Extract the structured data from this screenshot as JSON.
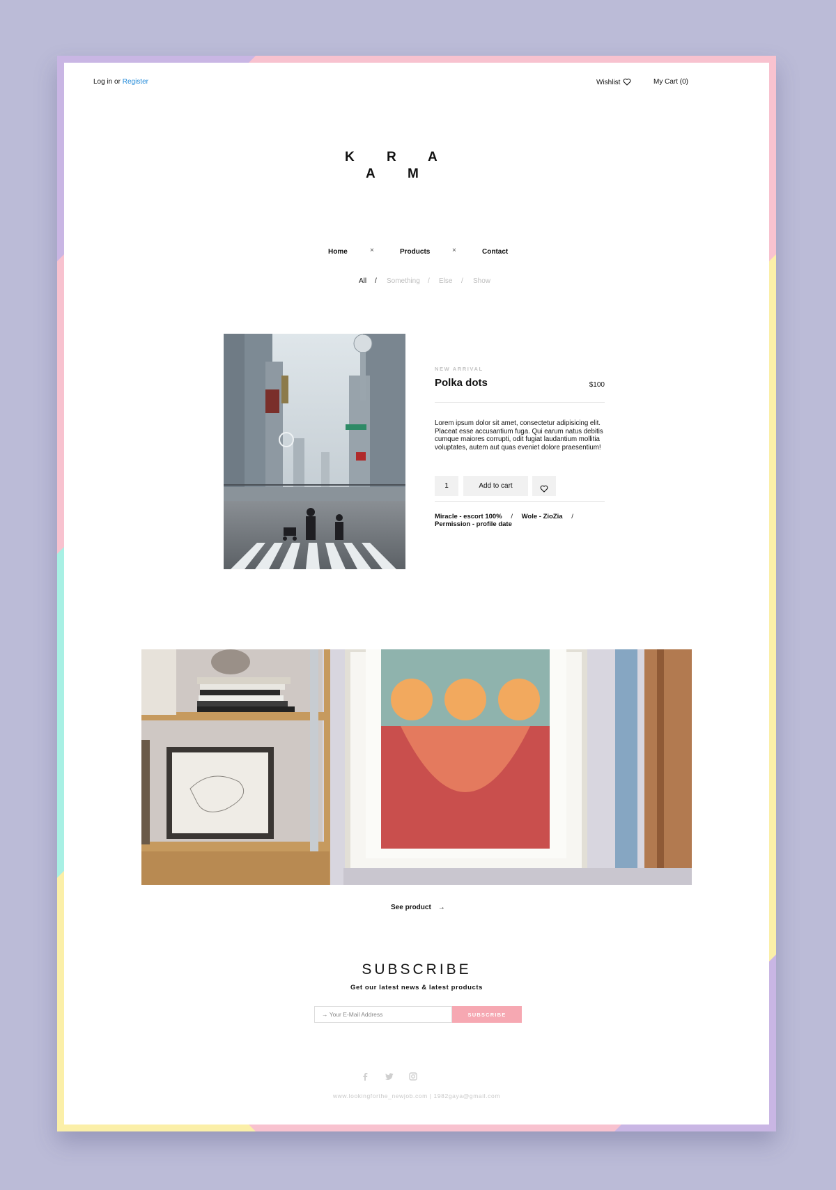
{
  "header": {
    "login_label": "Log in",
    "or_label": "or",
    "register_label": "Register",
    "wishlist_label": "Wishlist",
    "cart_label": "My Cart (0)"
  },
  "logo": {
    "letters": [
      "K",
      "R",
      "A",
      "A",
      "M"
    ]
  },
  "nav": {
    "items": [
      "Home",
      "Products",
      "Contact"
    ],
    "separator": "×"
  },
  "filters": {
    "items": [
      "All",
      "Something",
      "Else",
      "Show"
    ],
    "active": "All",
    "separator": "/"
  },
  "product": {
    "image_icon": "city-street-photo",
    "badge": "NEW ARRIVAL",
    "title": "Polka dots",
    "price": "$100",
    "description": "Lorem ipsum dolor sit amet, consectetur adipisicing elit. Placeat esse accusantium fuga. Qui earum natus debitis cumque maiores corrupti, odit fugiat laudantium mollitia voluptates, autem aut quas eveniet dolore praesentium!",
    "quantity": "1",
    "add_to_cart_label": "Add to cart",
    "wishlist_icon": "heart-icon",
    "tags": [
      "Miracle - escort 100%",
      "Wole - ZioZia",
      "Permission - profile date"
    ],
    "tag_separator": "/"
  },
  "banner": {
    "image_icon": "shelf-and-framed-art-photo",
    "see_product_label": "See product",
    "arrow": "→"
  },
  "subscribe": {
    "title": "SUBSCRIBE",
    "subtitle": "Get our latest news & latest products",
    "email_placeholder": "→ Your E-Mail Address",
    "button_label": "SUBSCRIBE"
  },
  "footer": {
    "social_icons": [
      "facebook-icon",
      "twitter-icon",
      "instagram-icon"
    ],
    "text": "www.lookingforthe_newjob.com  |  1982gaya@gmail.com"
  },
  "colors": {
    "background": "#bbbbd7",
    "accent_link": "#1e88d8",
    "subscribe_button": "#f6a8b2",
    "frame_purple": "#c9b6e4",
    "frame_pink": "#f8c2cf",
    "frame_yellow": "#fbefa8",
    "frame_mint": "#a8f0e4"
  }
}
